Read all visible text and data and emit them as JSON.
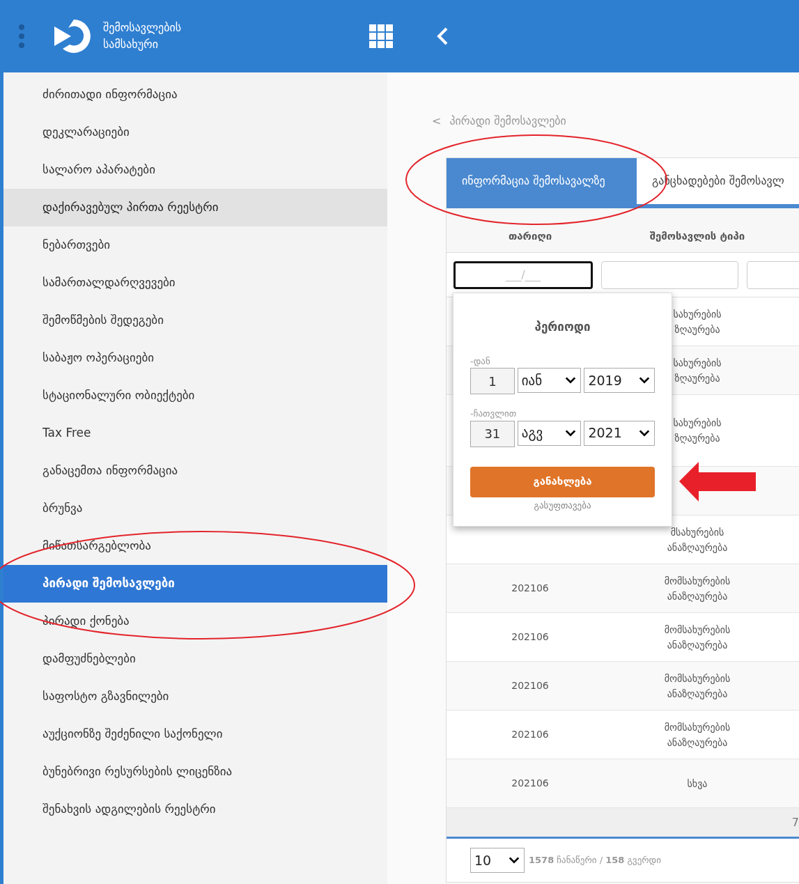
{
  "header": {
    "title_lines": [
      "შემოსავლების",
      "სამსახური"
    ]
  },
  "sidebar": {
    "items": [
      {
        "label": "ძირითადი ინფორმაცია",
        "selected": false,
        "hovered": false
      },
      {
        "label": "დეკლარაციები",
        "selected": false,
        "hovered": false
      },
      {
        "label": "სალარო აპარატები",
        "selected": false,
        "hovered": false
      },
      {
        "label": "დაქირავებულ პირთა რეესტრი",
        "selected": false,
        "hovered": true
      },
      {
        "label": "ნებართვები",
        "selected": false,
        "hovered": false
      },
      {
        "label": "სამართალდარღვევები",
        "selected": false,
        "hovered": false
      },
      {
        "label": "შემოწმების შედეგები",
        "selected": false,
        "hovered": false
      },
      {
        "label": "საბაჟო ოპერაციები",
        "selected": false,
        "hovered": false
      },
      {
        "label": "სტაციონალური ობიექტები",
        "selected": false,
        "hovered": false
      },
      {
        "label": "Tax Free",
        "selected": false,
        "hovered": false
      },
      {
        "label": "განაცემთა ინფორმაცია",
        "selected": false,
        "hovered": false
      },
      {
        "label": "ბრუნვა",
        "selected": false,
        "hovered": false
      },
      {
        "label": "მიწათსარგებლობა",
        "selected": false,
        "hovered": false
      },
      {
        "label": "პირადი შემოსავლები",
        "selected": true,
        "hovered": false
      },
      {
        "label": "პირადი ქონება",
        "selected": false,
        "hovered": false
      },
      {
        "label": "დამფუძნებლები",
        "selected": false,
        "hovered": false
      },
      {
        "label": "საფოსტო გზავნილები",
        "selected": false,
        "hovered": false
      },
      {
        "label": "აუქციონზე შეძენილი საქონელი",
        "selected": false,
        "hovered": false
      },
      {
        "label": "ბუნებრივი რესურსების ლიცენზია",
        "selected": false,
        "hovered": false
      },
      {
        "label": "შენახვის ადგილების რეესტრი",
        "selected": false,
        "hovered": false
      }
    ]
  },
  "breadcrumb": {
    "icon": "<",
    "label": "პირადი შემოსავლები"
  },
  "tabs": [
    {
      "label": "ინფორმაცია შემოსავალზე",
      "selected": true
    },
    {
      "label": "განცხადებები შემოსავლ",
      "selected": false
    }
  ],
  "table": {
    "columns": [
      "თარიღი",
      "შემოსავლის ტიპი"
    ],
    "filters": [
      {
        "placeholder": "___/___",
        "focused": true
      },
      {
        "focused": false
      },
      {
        "focused": false
      }
    ],
    "rows": [
      {
        "type": "სახურების ზღაურება"
      },
      {
        "type": "სახურების ზღაურება"
      },
      {
        "type": "სახურების ზღაურება",
        "tall": true
      },
      {},
      {
        "type": "მსახურების ანაზღაურება"
      },
      {
        "date": "202106",
        "type": "მომსახურების ანაზღაურება"
      },
      {
        "date": "202106",
        "type": "მომსახურების ანაზღაურება"
      },
      {
        "date": "202106",
        "type": "მომსახურების ანაზღაურება"
      },
      {
        "date": "202106",
        "type": "მომსახურების ანაზღაურება"
      },
      {
        "date": "202106",
        "type": "სხვა"
      }
    ],
    "summary": "7"
  },
  "pagination": {
    "page_size": "10",
    "summary": "**1578** ჩანაწერი / **158** გვერდი"
  },
  "period_popup": {
    "title": "პერიოდი",
    "from_label": "-დან",
    "from": {
      "day": "1",
      "month": "იან",
      "year": "2019"
    },
    "to_label": "-ჩათვლით",
    "to": {
      "day": "31",
      "month": "აგვ",
      "year": "2021"
    },
    "apply": "განახლება",
    "clear": "გასუფთავება"
  },
  "annotations": [
    {
      "kind": "ellipse"
    },
    {
      "kind": "ellipse"
    },
    {
      "kind": "arrow"
    }
  ]
}
